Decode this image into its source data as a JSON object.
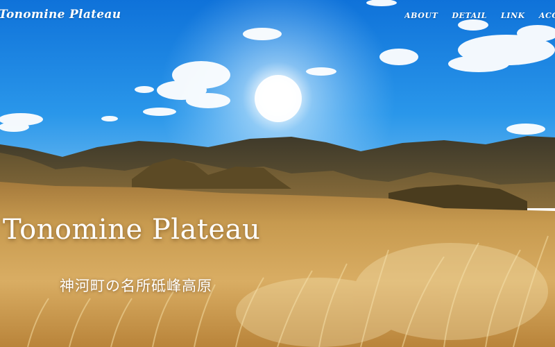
{
  "header": {
    "logo": "Tonomine Plateau",
    "nav": [
      {
        "label": "ABOUT"
      },
      {
        "label": "DETAIL"
      },
      {
        "label": "LINK"
      },
      {
        "label": "ACCESS"
      }
    ]
  },
  "hero": {
    "title": "Tonomine Plateau",
    "subtitle": "神河町の名所砥峰高原"
  },
  "colors": {
    "sky": "#1f8fe6",
    "grass": "#c9973f",
    "text": "#ffffff"
  }
}
